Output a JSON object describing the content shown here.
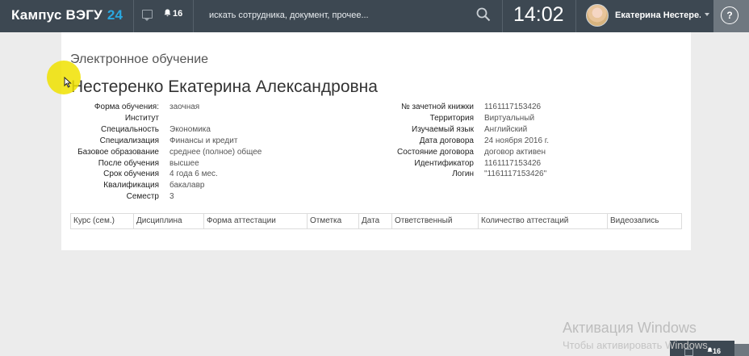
{
  "header": {
    "brand_name": "Кампус ВЭГУ",
    "brand_number": "24",
    "notifications_count": "16",
    "search_placeholder": "искать сотрудника, документ, прочее...",
    "clock": "14:02",
    "user_name": "Екатерина Нестере...",
    "help_label": "?"
  },
  "page": {
    "section_title": "Электронное обучение",
    "person_name": "Нестеренко Екатерина Александровна"
  },
  "left_info": [
    {
      "label": "Форма обучения:",
      "value": "заочная"
    },
    {
      "label": "Институт",
      "value": ""
    },
    {
      "label": "Специальность",
      "value": "Экономика"
    },
    {
      "label": "Специализация",
      "value": "Финансы и кредит"
    },
    {
      "label": "Базовое образование",
      "value": "среднее (полное) общее"
    },
    {
      "label": "После обучения",
      "value": "высшее"
    },
    {
      "label": "Срок обучения",
      "value": "4 года 6 мес."
    },
    {
      "label": "Квалификация",
      "value": "бакалавр"
    },
    {
      "label": "Семестр",
      "value": "3"
    }
  ],
  "right_info": [
    {
      "label": "№ зачетной книжки",
      "value": "1161117153426"
    },
    {
      "label": "Территория",
      "value": "Виртуальный"
    },
    {
      "label": "Изучаемый язык",
      "value": "Английский"
    },
    {
      "label": "Дата договора",
      "value": "24 ноября 2016 г."
    },
    {
      "label": "Состояние договора",
      "value": "договор активен"
    },
    {
      "label": "Идентификатор",
      "value": "1161117153426"
    },
    {
      "label": "Логин",
      "value": "\"1161117153426\""
    }
  ],
  "table": {
    "columns": [
      "Курс (сем.)",
      "Дисциплина",
      "Форма аттестации",
      "Отметка",
      "Дата",
      "Ответственный",
      "Количество аттестаций",
      "Видеозапись"
    ]
  },
  "taskbar": {
    "notifications_count": "16"
  },
  "watermark": {
    "line1": "Активация Windows",
    "line2": "Чтобы активировать Windows"
  }
}
